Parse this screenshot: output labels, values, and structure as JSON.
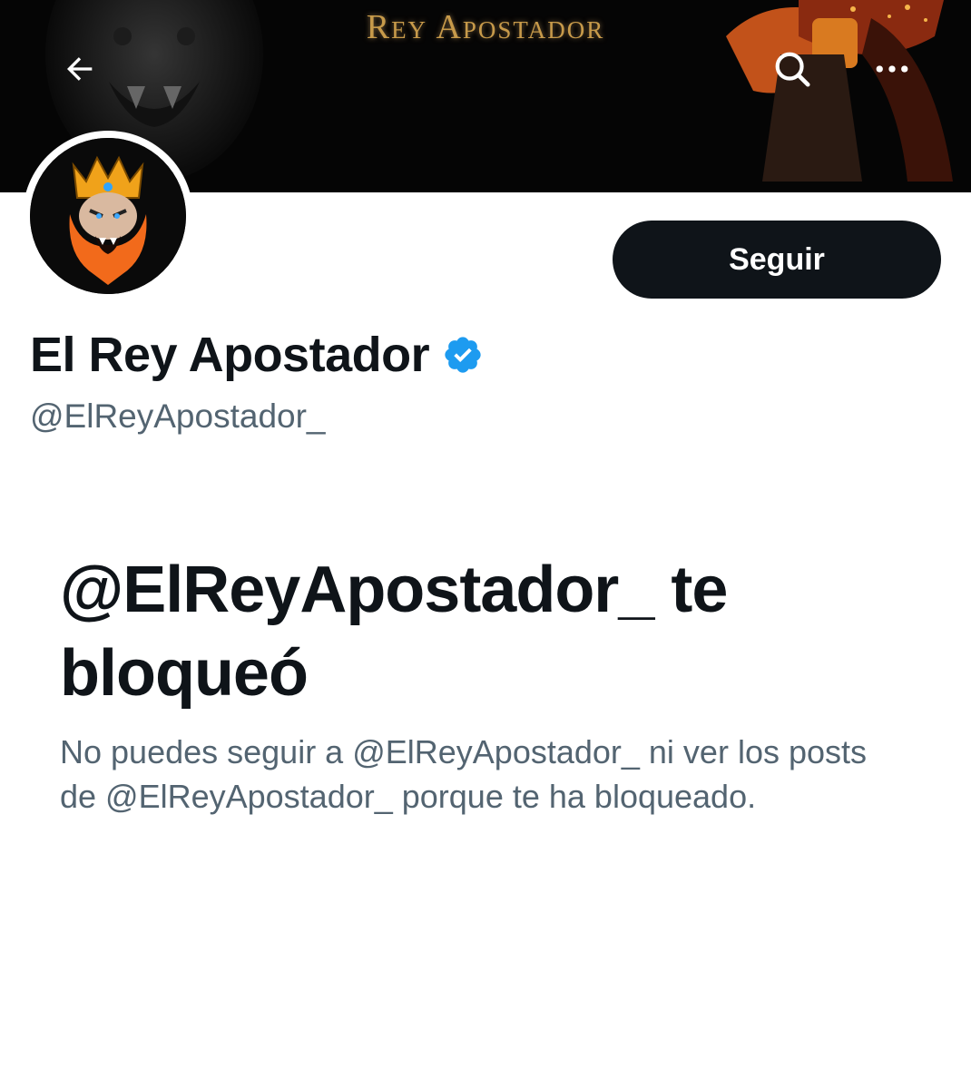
{
  "banner": {
    "title": "Rey Apostador"
  },
  "nav": {
    "back_icon": "arrow-left-icon",
    "search_icon": "search-icon",
    "more_icon": "more-horizontal-icon"
  },
  "profile": {
    "display_name": "El Rey Apostador",
    "handle": "@ElReyApostador_",
    "verified_color": "#1d9bf0"
  },
  "actions": {
    "follow_label": "Seguir"
  },
  "blocked_notice": {
    "title": "@ElReyApostador_ te bloqueó",
    "description": "No puedes seguir a @ElReyApostador_ ni ver los posts de @ElReyApostador_ porque te ha bloqueado."
  },
  "colors": {
    "text_primary": "#0f1419",
    "text_secondary": "#536471",
    "button_bg": "#0f1419",
    "banner_gold": "#c79a4a"
  }
}
